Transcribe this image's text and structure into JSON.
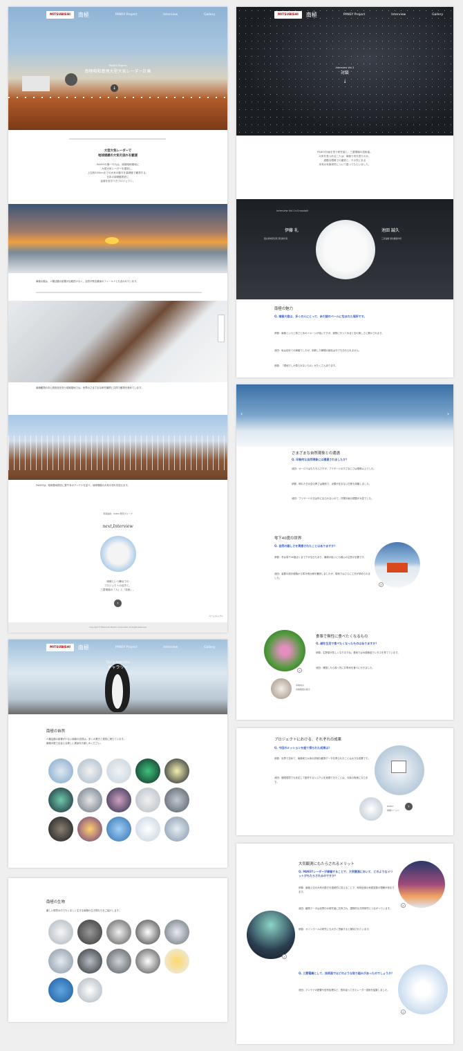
{
  "nav": {
    "logo": "MITSUBISHI",
    "logo_sub": "南極",
    "items": [
      "PANSY Project",
      "Interview",
      "Gallery"
    ]
  },
  "p1": {
    "hero_sub": "PANSY Project",
    "hero_title": "南極昭和基地大型大気レーダー計画",
    "lead_title": "大型大気レーダーで\n地球規模の大気の流れを観測",
    "lead_body": "PANSYの第一それは、南極昭和基地に\n大型大気レーダーを建設し、\n上空約500kmまでの大気の動きを高精度で観測する、\n日本の南極観測史に\n足跡を刻すべきプロジェクト。",
    "body1": "南極大陸は、人類活動の影響が比較的少なく、自然が残る最後のフィールドとも言われています。",
    "body2": "南極観測の中心的役割を担う昭和基地では、世界のさまざまな研究機関と共同で観測を進めています。",
    "body3": "PANSYは、昭和基地周辺に数千本のアンテナを並べ、地球規模の大気の流れを捉えます。",
    "caption": "写真提供：PANSY研究グループ",
    "next_label": "next,Interview",
    "next_body": "南極という舞台での\nプロジェクトの苦労と、\n三菱電機の「人」と「技術」。",
    "footer": "Copyright © Mitsubishi Electric Corporation All Rights Reserved",
    "pagetop": "ページトップへ"
  },
  "p2": {
    "hero_sub": "Interview Vol.1",
    "hero_title": "対談",
    "intro": "PANSY計画を担う研究者と、三菱電機の技術者。\n大気を見つめる二人は、南極で何を見たのか。\n過酷な環境での建設と、その先にある\n未来の気象研究について語ってもらいました。",
    "int_label": "Interview Vol.1×Crosstalk",
    "name_l": "伊藤 礼",
    "name_r": "池田 誠久",
    "role_l": "国立極地研究所 研究教育系",
    "role_r": "三菱電機 通信機製作所",
    "sec": "南極の魅力",
    "q1": "Q. 南極大陸は、多くの人にとって、未だ謎のベールに包まれた場所です。",
    "a1": "伊藤：南極というと寒さと氷のイメージが強いですが、実際に行ってみると空の美しさに驚かされます。",
    "a2": "池田：私は初めての南極でしたが、到着した瞬間の景色は今でも忘れられません。",
    "a3": "伊藤：「現地でしか見られないもの」がたくさんあります。"
  },
  "p3": {
    "sec": "さまざまな自然現象との遭遇",
    "q1": "Q. 印象的な自然現象には遭遇されましたか？",
    "a1": "池田：オーロラはもちろんですが、ブリザードのすさまじさは想像以上でした。",
    "a2": "伊藤：晴れた日の空の青さは格別で、太陽が沈まない白夜も体験しました。",
    "a3": "池田：ブリザードの日は外に出られないので、作業計画の調整が大変でした。",
    "sec2": "零下40度の世界",
    "q2": "Q. 自然の厳しさを実感されたことはありますか？",
    "a4": "伊藤：冬は零下40度近くまで下がる日もあり、機械の扱いにも細心の注意が必要です。",
    "a5": "池田：装置の設計段階から寒冷地仕様を徹底しましたが、現地ではさらに工夫が求められました。",
    "sec3": "食事で無性に食べたくなるもの",
    "q3": "Q. 越冬生活で食べたくなったものはありますか？",
    "a6": "伊藤：生野菜が恋しくなりますね。基地では水耕栽培でレタスを育てています。",
    "a7": "池田：帰国したら真っ先にお寿司を食べに行きました。",
    "photo_cap": "基地内の\n水耕栽培の様子"
  },
  "p4": {
    "sec": "プロジェクトにおける、それぞれの成果",
    "q": "Q. 今回のミッションを経て得られた成果は？",
    "a1": "伊藤：世界で初めて、南極域で大気の詳細な観測データを得られたことは大きな成果です。",
    "a2": "池田：極限環境でも安定して動作するシステムを実現できたことは、今後の財産になります。",
    "more": "PANSY\n詳細ページへ"
  },
  "p5": {
    "sec": "大気観測にもたらされるメリット",
    "q1": "Q. PANSYレーダーが稼働することで、大気観測において、どのようなメリットがもたらされるのですか？",
    "a1": "伊藤：南極上空の大気の動きを連続的に捉えることで、地球全体の気候変動の理解が深まります。",
    "a2": "池田：観測データは世界中の研究者に共有され、国際的な共同研究につながっています。",
    "a3": "伊藤：オゾンホールの研究にも大きく貢献すると期待されています。",
    "q2": "Q. 三菱電機として、技術面ではどのような取り組みがあったのでしょうか？",
    "a4": "池田：アンテナの配置や信号処理など、長年培ってきたレーダー技術を結集しました。"
  },
  "p6": {
    "hero_sub": "This is Antarctica",
    "hero_title": "ギャラリー",
    "sec": "南極の自然",
    "body": "人類活動の影響が少ない南極の自然は、多くの驚きと発見に満ちています。\n南極大陸で出会える美しい風景をお楽しみください。"
  },
  "p7": {
    "sec": "南極の生物",
    "body": "厳しい環境の中でたくましく生きる南極の生き物たちをご紹介します。"
  },
  "colors": {
    "accent": "#3b5fc4",
    "brand": "#cc0000"
  }
}
